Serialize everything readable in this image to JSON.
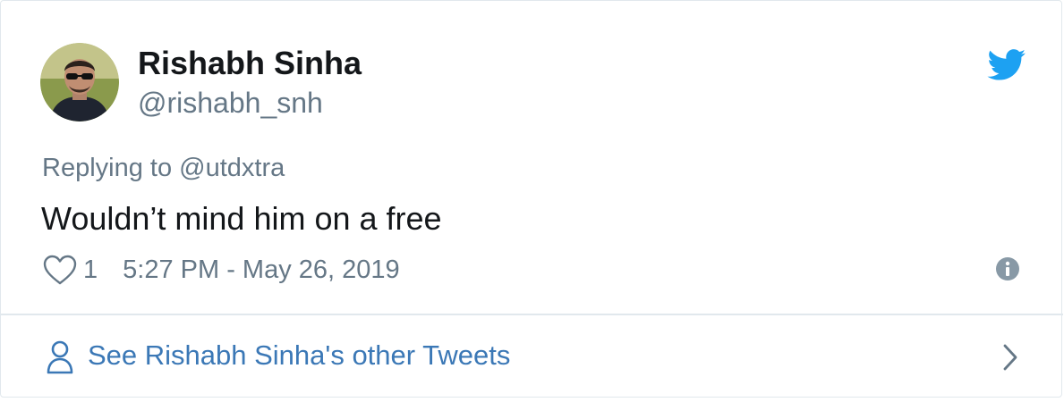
{
  "tweet": {
    "author": {
      "display_name": "Rishabh Sinha",
      "handle": "@rishabh_snh",
      "avatar_icon": "profile-photo"
    },
    "reply": {
      "prefix": "Replying to",
      "target": "@utdxtra"
    },
    "text": "Wouldn’t mind him on a free",
    "likes": "1",
    "timestamp": "5:27 PM - May 26, 2019"
  },
  "footer": {
    "other_tweets_label": "See Rishabh Sinha's other Tweets"
  },
  "icons": {
    "brand": "twitter-bird-icon",
    "like": "heart-icon",
    "info": "info-icon",
    "profile": "person-icon",
    "navigate": "chevron-right-icon"
  },
  "colors": {
    "twitter_blue": "#1da1f2",
    "link_blue": "#3b78b6",
    "text_primary": "#14171a",
    "text_secondary": "#657786",
    "border": "#e1e8ed"
  }
}
